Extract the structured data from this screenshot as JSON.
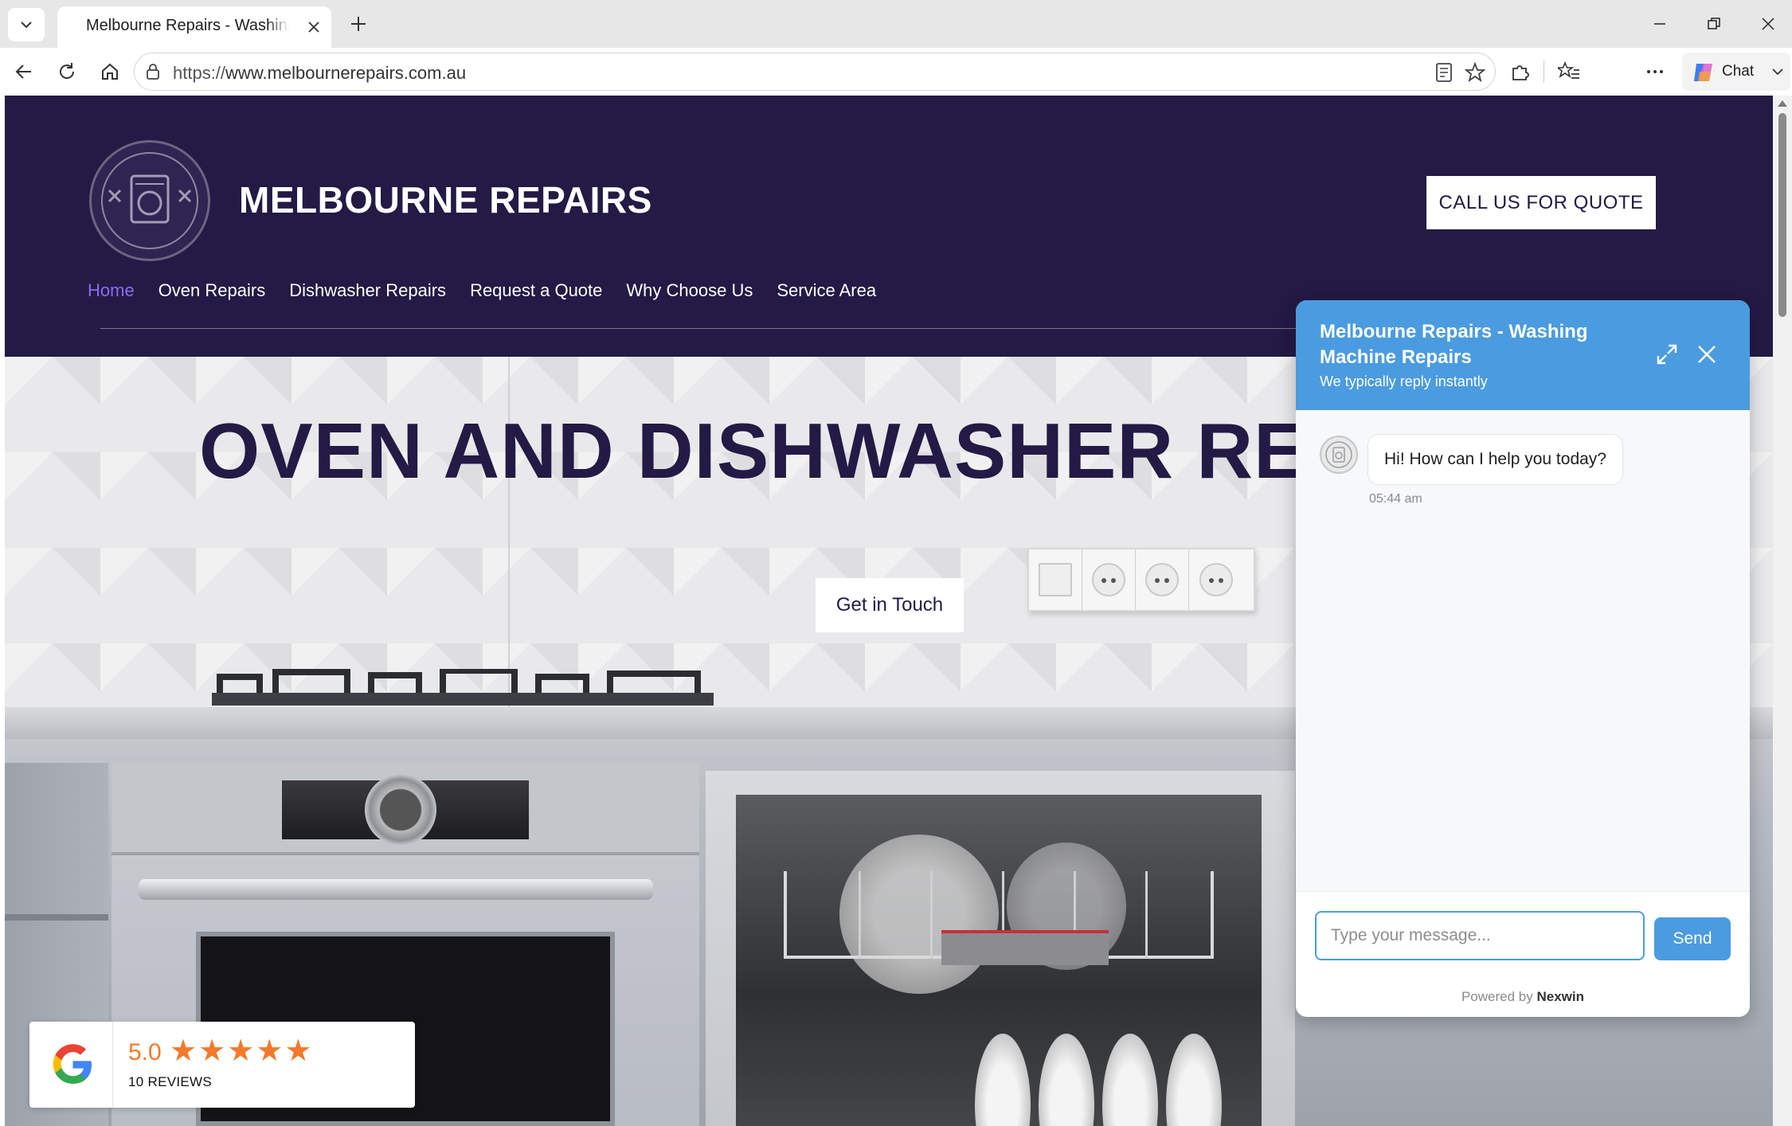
{
  "browser": {
    "tab_title": "Melbourne Repairs - Washing Machine Repairs",
    "url_protocol": "https://",
    "url_host": "www.melbournerepairs.com.au",
    "chat_label": "Chat"
  },
  "site": {
    "name": "MELBOURNE REPAIRS",
    "quote_button": "CALL US FOR QUOTE",
    "nav": [
      {
        "label": "Home",
        "active": true
      },
      {
        "label": "Oven Repairs",
        "active": false
      },
      {
        "label": "Dishwasher Repairs",
        "active": false
      },
      {
        "label": "Request a Quote",
        "active": false
      },
      {
        "label": "Why Choose Us",
        "active": false
      },
      {
        "label": "Service Area",
        "active": false
      }
    ]
  },
  "hero": {
    "title": "OVEN AND DISHWASHER REPAIRS",
    "cta": "Get in Touch"
  },
  "reviews": {
    "rating": "5.0",
    "stars": 5,
    "count": "10 REVIEWS"
  },
  "chat_widget": {
    "title": "Melbourne Repairs - Washing Machine Repairs",
    "subtitle": "We typically reply instantly",
    "messages": [
      {
        "from": "agent",
        "text": "Hi! How can I help you today?",
        "time": "05:44 am"
      }
    ],
    "input_placeholder": "Type your message...",
    "send_label": "Send",
    "powered_by_prefix": "Powered by",
    "powered_by_brand": "Nexwin"
  },
  "colors": {
    "header_bg": "#231a45",
    "nav_active": "#8b6cf0",
    "chat_accent": "#4b9be0",
    "review_orange": "#f4792a"
  }
}
